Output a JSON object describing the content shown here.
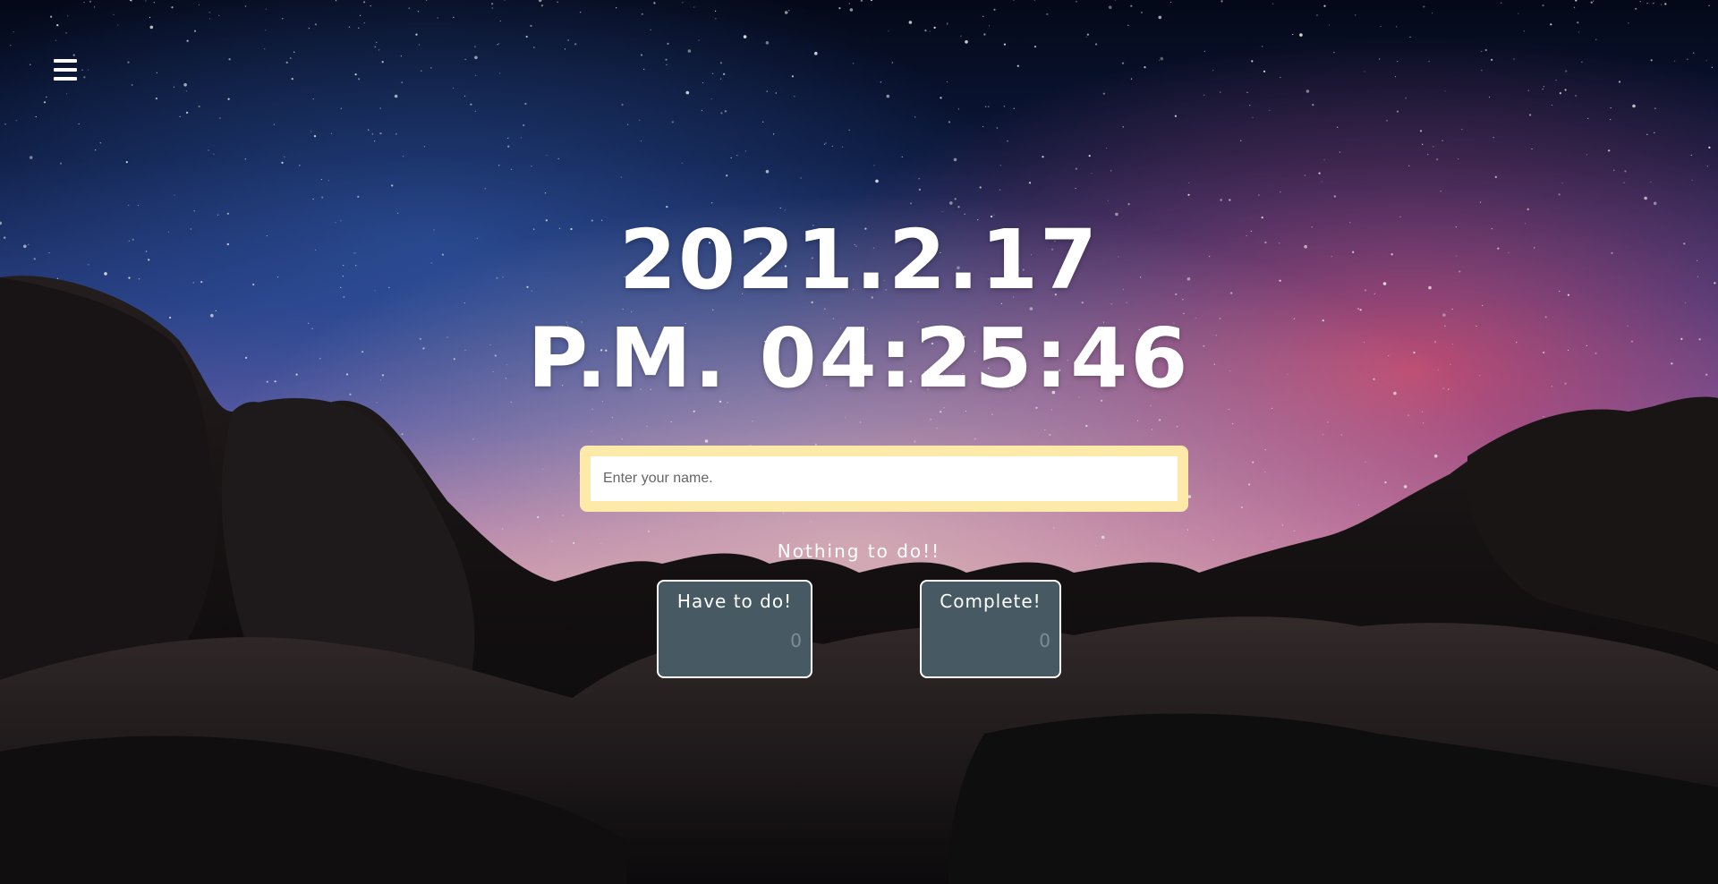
{
  "clock": {
    "date": "2021.2.17",
    "time": "P.M. 04:25:46"
  },
  "name_form": {
    "placeholder": "Enter your name."
  },
  "status": {
    "text": "Nothing to do!!"
  },
  "cards": {
    "todo": {
      "label": "Have to do!",
      "count": "0"
    },
    "complete": {
      "label": "Complete!",
      "count": "0"
    }
  },
  "menu": {
    "icon": "hamburger-menu-icon"
  },
  "colors": {
    "form_background": "#fde9a8",
    "card_background": "#475a63",
    "card_border": "#ffffff",
    "text": "#ffffff"
  }
}
